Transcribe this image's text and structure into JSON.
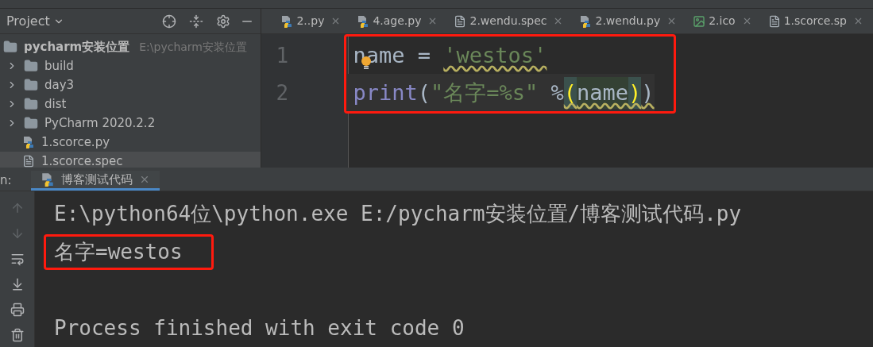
{
  "project_panel": {
    "title": "Project",
    "tree": [
      {
        "name": "pycharm安装位置",
        "path": "E:\\pycharm安装位置",
        "kind": "root",
        "selected": false,
        "children": [
          {
            "name": "build",
            "kind": "folder",
            "selected": false
          },
          {
            "name": "day3",
            "kind": "folder",
            "selected": false
          },
          {
            "name": "dist",
            "kind": "folder",
            "selected": false
          },
          {
            "name": "PyCharm 2020.2.2",
            "kind": "folder",
            "selected": false
          },
          {
            "name": "1.scorce.py",
            "kind": "python",
            "selected": false
          },
          {
            "name": "1.scorce.spec",
            "kind": "text",
            "selected": true
          }
        ]
      }
    ]
  },
  "editor_tabs": [
    {
      "label": "2..py",
      "kind": "python",
      "selected": false
    },
    {
      "label": "4.age.py",
      "kind": "python",
      "selected": false
    },
    {
      "label": "2.wendu.spec",
      "kind": "text",
      "selected": false
    },
    {
      "label": "2.wendu.py",
      "kind": "python",
      "selected": false
    },
    {
      "label": "2.ico",
      "kind": "image",
      "selected": false
    },
    {
      "label": "1.scorce.sp",
      "kind": "text",
      "selected": false
    }
  ],
  "editor": {
    "framed": true,
    "lines": [
      {
        "number": "1",
        "current": false,
        "tokens": [
          {
            "text": "name",
            "kind": "plain",
            "warning": false
          },
          {
            "text": " = ",
            "kind": "plain",
            "warning": false
          },
          {
            "text": "'westos'",
            "kind": "string",
            "warning": true
          }
        ]
      },
      {
        "number": "2",
        "current": true,
        "tokens": [
          {
            "text": "print",
            "kind": "builtin",
            "warning": false
          },
          {
            "text": "(",
            "kind": "plain",
            "warning": false
          },
          {
            "text": "\"名字=%s\"",
            "kind": "string",
            "warning": false
          },
          {
            "text": " %",
            "kind": "plain",
            "warning": false
          },
          {
            "text": "(",
            "kind": "match",
            "warning": true
          },
          {
            "text": "name",
            "kind": "highlight",
            "warning": true
          },
          {
            "text": ")",
            "kind": "match",
            "warning": true
          },
          {
            "text": ")",
            "kind": "plain",
            "warning": true
          }
        ]
      }
    ]
  },
  "run_panel": {
    "label": "n:",
    "tabs": [
      {
        "label": "博客测试代码",
        "selected": true
      }
    ],
    "console": {
      "command": "E:\\python64位\\python.exe E:/pycharm安装位置/博客测试代码.py",
      "output": {
        "text": "名字=westos",
        "framed": true
      },
      "exit_message": "Process finished with exit code 0"
    }
  }
}
